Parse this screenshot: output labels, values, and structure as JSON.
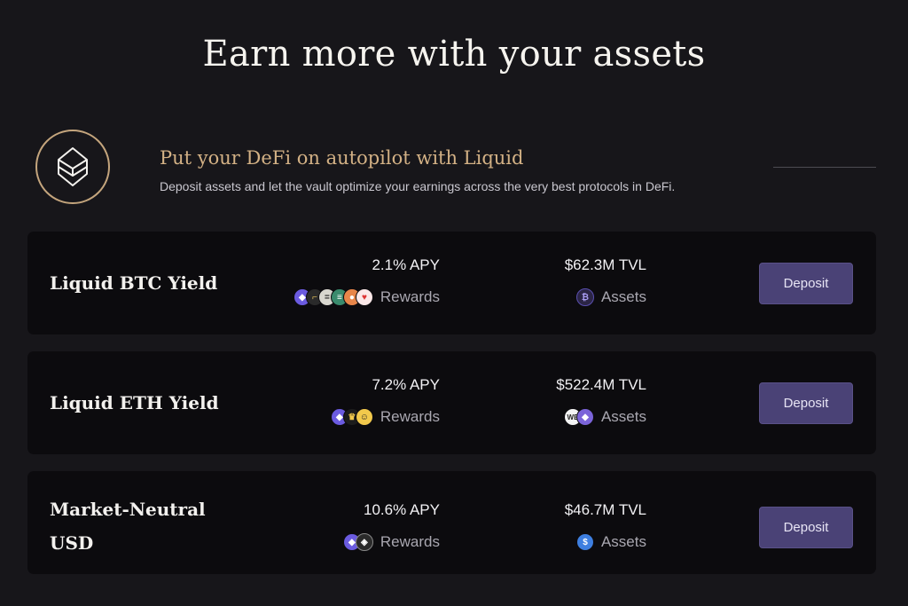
{
  "page": {
    "title": "Earn more with your assets"
  },
  "intro": {
    "heading": "Put your DeFi on autopilot with Liquid",
    "subtitle": "Deposit assets and let the vault optimize your earnings across the very best protocols in DeFi."
  },
  "vaults": [
    {
      "name_lines": [
        "Liquid BTC Yield"
      ],
      "apy": "2.1% APY",
      "rewards_label": "Rewards",
      "tvl": "$62.3M TVL",
      "assets_label": "Assets",
      "deposit_label": "Deposit",
      "reward_icons": [
        "ether.fi-icon",
        "token-icon",
        "token-icon",
        "token-icon",
        "token-icon",
        "token-icon"
      ],
      "asset_icons": [
        "bitcoin-icon"
      ]
    },
    {
      "name_lines": [
        "Liquid ETH Yield"
      ],
      "apy": "7.2% APY",
      "rewards_label": "Rewards",
      "tvl": "$522.4M TVL",
      "assets_label": "Assets",
      "deposit_label": "Deposit",
      "reward_icons": [
        "ether.fi-icon",
        "token-icon",
        "token-icon"
      ],
      "asset_icons": [
        "weeth-icon",
        "ethereum-icon"
      ]
    },
    {
      "name_lines": [
        "Market-Neutral",
        "USD"
      ],
      "apy": "10.6% APY",
      "rewards_label": "Rewards",
      "tvl": "$46.7M TVL",
      "assets_label": "Assets",
      "deposit_label": "Deposit",
      "reward_icons": [
        "ether.fi-icon",
        "ethena-icon"
      ],
      "asset_icons": [
        "usd-icon"
      ]
    }
  ],
  "colors": {
    "background": "#17161a",
    "card": "#0c0b0e",
    "accent_gold": "#d3b185",
    "button": "#4a4276"
  }
}
